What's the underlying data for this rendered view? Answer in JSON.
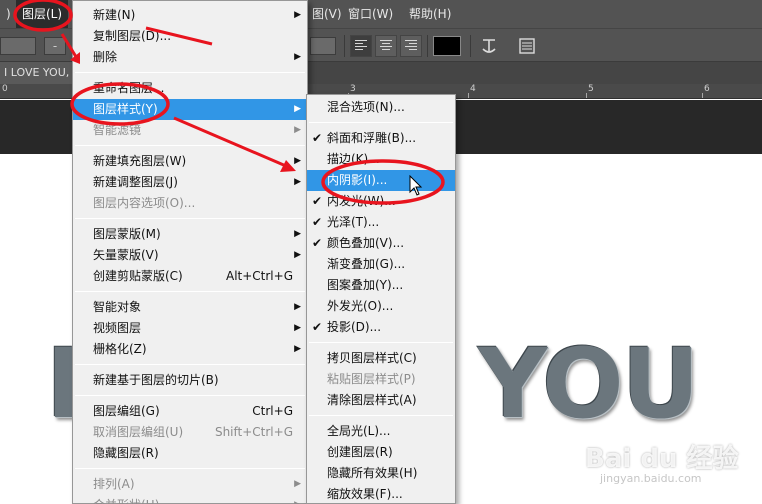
{
  "menubar": {
    "left_fragment": ")",
    "layer_menu": "图层(L)",
    "right_fragment": "图(V)",
    "window_menu": "窗口(W)",
    "help_menu": "帮助(H)"
  },
  "options_bar": {
    "field_fragment": "-",
    "swatch_color": "#000000"
  },
  "document": {
    "tab_label": "I LOVE YOU,",
    "ruler_numbers": [
      "0",
      "3",
      "4",
      "5",
      "6"
    ]
  },
  "canvas": {
    "word_right": "YOU",
    "word_left_fragment": "I",
    "watermark": "Bai du 经验",
    "watermark_sub": "jingyan.baidu.com"
  },
  "layer_menu": {
    "groups": [
      [
        {
          "label": "新建(N)",
          "submenu": true
        },
        {
          "label": "复制图层(D)...",
          "submenu": false
        },
        {
          "label": "删除",
          "submenu": true
        }
      ],
      [
        {
          "label": "重命名图层...",
          "submenu": false
        },
        {
          "label": "图层样式(Y)",
          "submenu": true,
          "highlighted": true
        },
        {
          "label": "智能滤镜",
          "submenu": true,
          "disabled": true
        }
      ],
      [
        {
          "label": "新建填充图层(W)",
          "submenu": true
        },
        {
          "label": "新建调整图层(J)",
          "submenu": true
        },
        {
          "label": "图层内容选项(O)...",
          "submenu": false,
          "disabled": true
        }
      ],
      [
        {
          "label": "图层蒙版(M)",
          "submenu": true
        },
        {
          "label": "矢量蒙版(V)",
          "submenu": true
        },
        {
          "label": "创建剪贴蒙版(C)",
          "shortcut": "Alt+Ctrl+G"
        }
      ],
      [
        {
          "label": "智能对象",
          "submenu": true
        },
        {
          "label": "视频图层",
          "submenu": true
        },
        {
          "label": "栅格化(Z)",
          "submenu": true
        }
      ],
      [
        {
          "label": "新建基于图层的切片(B)"
        }
      ],
      [
        {
          "label": "图层编组(G)",
          "shortcut": "Ctrl+G"
        },
        {
          "label": "取消图层编组(U)",
          "shortcut": "Shift+Ctrl+G",
          "disabled": true
        },
        {
          "label": "隐藏图层(R)"
        }
      ],
      [
        {
          "label": "排列(A)",
          "submenu": true,
          "disabled": true
        },
        {
          "label": "合并形状(H)",
          "submenu": true,
          "disabled": true
        }
      ]
    ]
  },
  "style_menu": {
    "groups": [
      [
        {
          "label": "混合选项(N)..."
        }
      ],
      [
        {
          "label": "斜面和浮雕(B)...",
          "checked": true
        },
        {
          "label": "描边(K)...",
          "checked": false
        },
        {
          "label": "内阴影(I)...",
          "checked": false,
          "highlighted": true
        },
        {
          "label": "内发光(W)...",
          "checked": true
        },
        {
          "label": "光泽(T)...",
          "checked": true
        },
        {
          "label": "颜色叠加(V)...",
          "checked": true
        },
        {
          "label": "渐变叠加(G)...",
          "checked": false
        },
        {
          "label": "图案叠加(Y)...",
          "checked": false
        },
        {
          "label": "外发光(O)...",
          "checked": false
        },
        {
          "label": "投影(D)...",
          "checked": true
        }
      ],
      [
        {
          "label": "拷贝图层样式(C)"
        },
        {
          "label": "粘贴图层样式(P)",
          "disabled": true
        },
        {
          "label": "清除图层样式(A)"
        }
      ],
      [
        {
          "label": "全局光(L)..."
        },
        {
          "label": "创建图层(R)"
        },
        {
          "label": "隐藏所有效果(H)"
        },
        {
          "label": "缩放效果(F)..."
        }
      ]
    ]
  },
  "glyphs": {
    "submenu_arrow": "▶",
    "check": "✔"
  },
  "colors": {
    "highlight": "#3196e6",
    "annotation": "#e8141e",
    "chrome": "#535353"
  }
}
